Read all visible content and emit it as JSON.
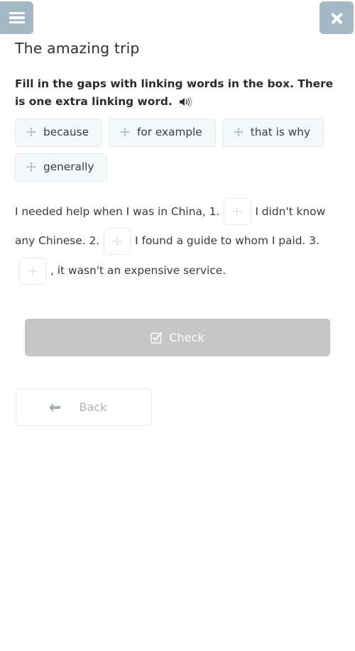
{
  "header": {
    "menu_icon": "hamburger-menu-icon",
    "close_icon": "close-icon",
    "button_color": "#a3b9c6"
  },
  "title": "The amazing trip",
  "instruction": {
    "text": "Fill in the gaps with linking words in the box. There is one extra linking word.",
    "audio_icon": "speaker-icon"
  },
  "word_bank": {
    "drag_icon": "move-arrows-icon",
    "chips": [
      {
        "label": "because"
      },
      {
        "label": "for example"
      },
      {
        "label": "that is why"
      },
      {
        "label": "generally"
      }
    ]
  },
  "exercise": {
    "gap_icon": "move-arrows-icon",
    "segments": [
      {
        "type": "text",
        "value": "I needed help when I was in China, 1."
      },
      {
        "type": "gap",
        "number": "1",
        "value": ""
      },
      {
        "type": "text",
        "value": "I didn't know any Chinese. 2."
      },
      {
        "type": "gap",
        "number": "2",
        "value": ""
      },
      {
        "type": "text",
        "value": "I found a guide to whom I paid. 3."
      },
      {
        "type": "gap",
        "number": "3",
        "value": ""
      },
      {
        "type": "text",
        "value": ", it wasn't an expensive service."
      }
    ]
  },
  "actions": {
    "check_label": "Check",
    "check_icon": "checkbox-check-icon",
    "check_color": "#c6c6c6",
    "back_label": "Back",
    "back_icon": "arrow-left-icon",
    "back_text_color": "#a9b4bb"
  }
}
